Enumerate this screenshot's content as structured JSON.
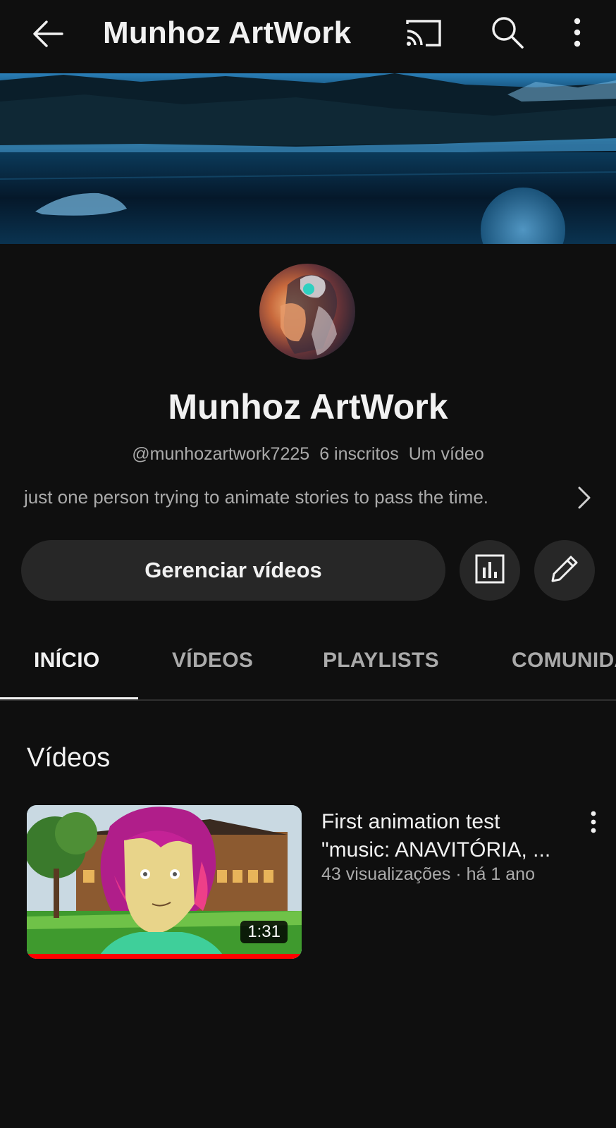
{
  "topbar": {
    "title": "Munhoz ArtWork",
    "icons": [
      "back-arrow-icon",
      "cast-icon",
      "search-icon",
      "more-vert-icon"
    ]
  },
  "channel": {
    "name": "Munhoz ArtWork",
    "handle": "@munhozartwork7225",
    "subscribers": "6 inscritos",
    "videos_count": "Um vídeo",
    "description": "just one person trying to animate stories to pass the time."
  },
  "actions": {
    "manage_label": "Gerenciar vídeos",
    "icons": [
      "analytics-icon",
      "edit-pencil-icon"
    ]
  },
  "tabs": [
    {
      "label": "INÍCIO",
      "active": true
    },
    {
      "label": "VÍDEOS",
      "active": false
    },
    {
      "label": "PLAYLISTS",
      "active": false
    },
    {
      "label": "COMUNIDADE",
      "active": false
    }
  ],
  "section": {
    "title": "Vídeos"
  },
  "videos": [
    {
      "title_line1": "First animation test",
      "title_line2": "\"music: ANAVITÓRIA, ...",
      "meta": "43 visualizações · há 1 ano",
      "duration": "1:31",
      "watched_fraction": 1.0
    }
  ],
  "colors": {
    "background": "#0f0f0f",
    "surface": "#272727",
    "text_primary": "#f1f1f1",
    "text_secondary": "#aaaaaa",
    "progress": "#ff0000"
  }
}
